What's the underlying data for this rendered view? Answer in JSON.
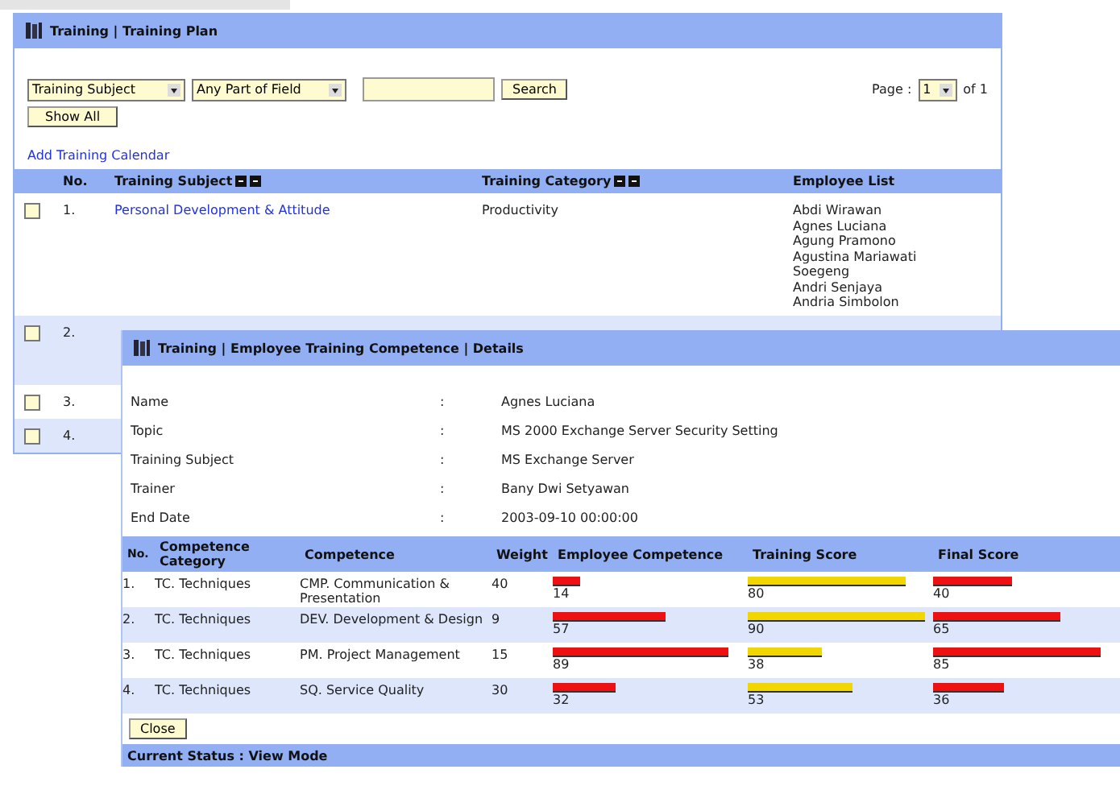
{
  "plan": {
    "title": "Training | Training Plan",
    "filters": {
      "field": "Training Subject",
      "match": "Any Part of Field",
      "search": "Search",
      "show_all": "Show All"
    },
    "pager": {
      "label": "Page :",
      "page": "1",
      "of": "of 1"
    },
    "add_link": "Add Training Calendar",
    "columns": [
      "No.",
      "Training Subject",
      "Training Category",
      "Employee List"
    ],
    "rows": [
      {
        "no": "1.",
        "checked": false,
        "subject": "Personal Development & Attitude",
        "category": "Productivity",
        "employees": [
          "Abdi Wirawan",
          "Agnes Luciana",
          "Agung Pramono",
          "Agustina Mariawati",
          "Soegeng",
          "Andri Senjaya",
          "Andria Simbolon"
        ]
      },
      {
        "no": "2.",
        "checked": false
      },
      {
        "no": "3.",
        "checked": false
      },
      {
        "no": "4.",
        "checked": false
      }
    ]
  },
  "details": {
    "title": "Training | Employee Training Competence | Details",
    "fields": [
      {
        "label": "Name",
        "value": "Agnes Luciana"
      },
      {
        "label": "Topic",
        "value": "MS 2000 Exchange Server Security Setting"
      },
      {
        "label": "Training Subject",
        "value": "MS Exchange Server"
      },
      {
        "label": "Trainer",
        "value": "Bany Dwi Setyawan"
      },
      {
        "label": "End Date",
        "value": "2003-09-10 00:00:00"
      }
    ],
    "separator": ":",
    "columns": [
      "No.",
      "Competence Category",
      "Competence",
      "Weight",
      "Employee Competence",
      "Training Score",
      "Final Score"
    ],
    "rows": [
      {
        "no": "1.",
        "category": "TC. Techniques",
        "competence": "CMP. Communication & Presentation",
        "weight": "40",
        "employee": {
          "reading": "14"
        },
        "training": {
          "reading": "80"
        },
        "final": {
          "reading": "40"
        }
      },
      {
        "no": "2.",
        "category": "TC. Techniques",
        "competence": "DEV. Development & Design",
        "weight": "9",
        "employee": {
          "reading": "57"
        },
        "training": {
          "reading": "90"
        },
        "final": {
          "reading": "65"
        }
      },
      {
        "no": "3.",
        "category": "TC. Techniques",
        "competence": "PM. Project Management",
        "weight": "15",
        "employee": {
          "reading": "89"
        },
        "training": {
          "reading": "38"
        },
        "final": {
          "reading": "85"
        }
      },
      {
        "no": "4.",
        "category": "TC. Techniques",
        "competence": "SQ. Service Quality",
        "weight": "30",
        "employee": {
          "reading": "32"
        },
        "training": {
          "reading": "53"
        },
        "final": {
          "reading": "36"
        }
      }
    ],
    "close": "Close",
    "status": "Current Status : View Mode"
  }
}
